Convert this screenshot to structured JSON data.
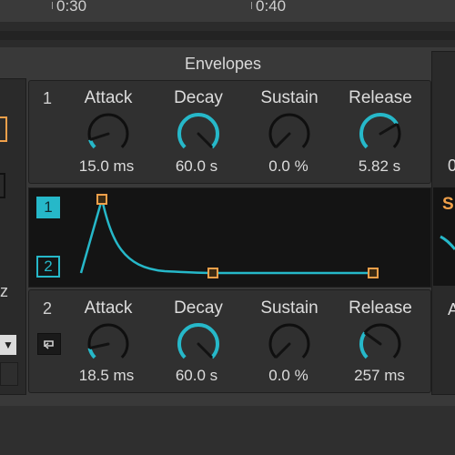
{
  "timeline": {
    "marks": [
      "0:30",
      "0:40"
    ]
  },
  "device": {
    "section_title": "Envelopes"
  },
  "envelopes": [
    {
      "number": "1",
      "knobs": [
        {
          "label": "Attack",
          "value": "15.0 ms",
          "level": 0.1
        },
        {
          "label": "Decay",
          "value": "60.0 s",
          "level": 1.0
        },
        {
          "label": "Sustain",
          "value": "0.0 %",
          "level": 0.0
        },
        {
          "label": "Release",
          "value": "5.82 s",
          "level": 0.72
        }
      ]
    },
    {
      "number": "2",
      "knobs": [
        {
          "label": "Attack",
          "value": "18.5 ms",
          "level": 0.12
        },
        {
          "label": "Decay",
          "value": "60.0 s",
          "level": 1.0
        },
        {
          "label": "Sustain",
          "value": "0.0 %",
          "level": 0.0
        },
        {
          "label": "Release",
          "value": "257 ms",
          "level": 0.3
        }
      ]
    }
  ],
  "graph": {
    "selector_1": "1",
    "selector_2": "2",
    "active": "1"
  },
  "left_panel": {
    "text": "z"
  },
  "right_panel": {
    "letter_orange": "S",
    "letter_gray": "A",
    "zero": "0"
  },
  "colors": {
    "accent": "#26b8c9",
    "orange": "#f0a04a",
    "knob_track": "#0f0f0f"
  }
}
